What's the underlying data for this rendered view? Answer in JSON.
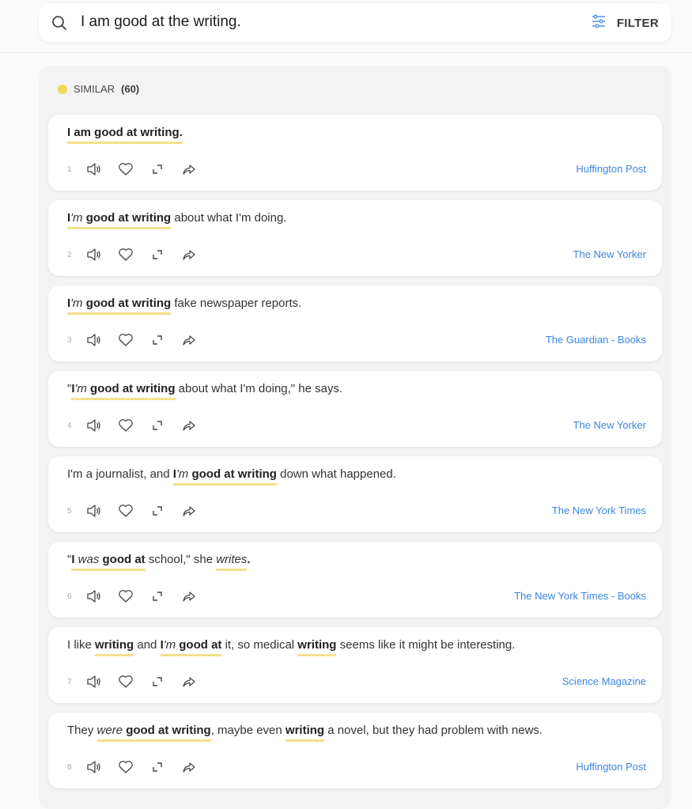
{
  "search": {
    "value": "I am good at the writing.",
    "filter_label": "FILTER",
    "search_icon": "search-icon",
    "filter_icon": "sliders-icon"
  },
  "section": {
    "label": "SIMILAR",
    "count": "(60)",
    "dot_color": "#f2d85a"
  },
  "colors": {
    "highlight": "#f4e08a",
    "source_link": "#3b86e0"
  },
  "results": [
    {
      "index": "1",
      "source": "Huffington Post",
      "segments": [
        {
          "t": "I am good at writing.",
          "b": true,
          "hl": true
        }
      ]
    },
    {
      "index": "2",
      "source": "The New Yorker",
      "segments": [
        {
          "t": "I",
          "b": true,
          "hl": true
        },
        {
          "t": "'m",
          "i": true,
          "hl": true
        },
        {
          "t": " good at writing",
          "b": true,
          "hl": true
        },
        {
          "t": " about what I'm doing."
        }
      ]
    },
    {
      "index": "3",
      "source": "The Guardian - Books",
      "segments": [
        {
          "t": "I",
          "b": true,
          "hl": true
        },
        {
          "t": "'m",
          "i": true,
          "hl": true
        },
        {
          "t": " good at writing",
          "b": true,
          "hl": true
        },
        {
          "t": " fake newspaper reports."
        }
      ]
    },
    {
      "index": "4",
      "source": "The New Yorker",
      "segments": [
        {
          "t": "\""
        },
        {
          "t": "I",
          "b": true,
          "hl": true
        },
        {
          "t": "'m",
          "i": true,
          "hl": true
        },
        {
          "t": " good at writing",
          "b": true,
          "hl": true
        },
        {
          "t": " about what I'm doing,\" he says."
        }
      ]
    },
    {
      "index": "5",
      "source": "The New York Times",
      "segments": [
        {
          "t": "I'm a journalist, and "
        },
        {
          "t": "I",
          "b": true,
          "hl": true
        },
        {
          "t": "'m",
          "i": true,
          "hl": true
        },
        {
          "t": " good at writing",
          "b": true,
          "hl": true
        },
        {
          "t": " down what happened."
        }
      ]
    },
    {
      "index": "6",
      "source": "The New York Times - Books",
      "segments": [
        {
          "t": "\""
        },
        {
          "t": "I",
          "b": true,
          "hl": true
        },
        {
          "t": " was",
          "i": true,
          "hl": true
        },
        {
          "t": " good at",
          "b": true,
          "hl": true
        },
        {
          "t": " school,\" she "
        },
        {
          "t": "writes",
          "i": true,
          "hl": true
        },
        {
          "t": ".",
          "b": true
        }
      ]
    },
    {
      "index": "7",
      "source": "Science Magazine",
      "segments": [
        {
          "t": "I like "
        },
        {
          "t": "writing",
          "b": true,
          "hl": true
        },
        {
          "t": " and "
        },
        {
          "t": "I",
          "b": true,
          "hl": true
        },
        {
          "t": "'m",
          "i": true,
          "hl": true
        },
        {
          "t": " good at",
          "b": true,
          "hl": true
        },
        {
          "t": " it, so medical "
        },
        {
          "t": "writing",
          "b": true,
          "hl": true
        },
        {
          "t": " seems like it might be interesting."
        }
      ]
    },
    {
      "index": "8",
      "source": "Huffington Post",
      "segments": [
        {
          "t": "They "
        },
        {
          "t": "were",
          "i": true,
          "hl": true
        },
        {
          "t": " good at writing",
          "b": true,
          "hl": true
        },
        {
          "t": ", maybe even "
        },
        {
          "t": "writing",
          "b": true,
          "hl": true
        },
        {
          "t": " a novel, but they had problem with news."
        }
      ]
    }
  ],
  "action_icons": [
    "speaker-icon",
    "heart-icon",
    "expand-icon",
    "share-icon"
  ]
}
